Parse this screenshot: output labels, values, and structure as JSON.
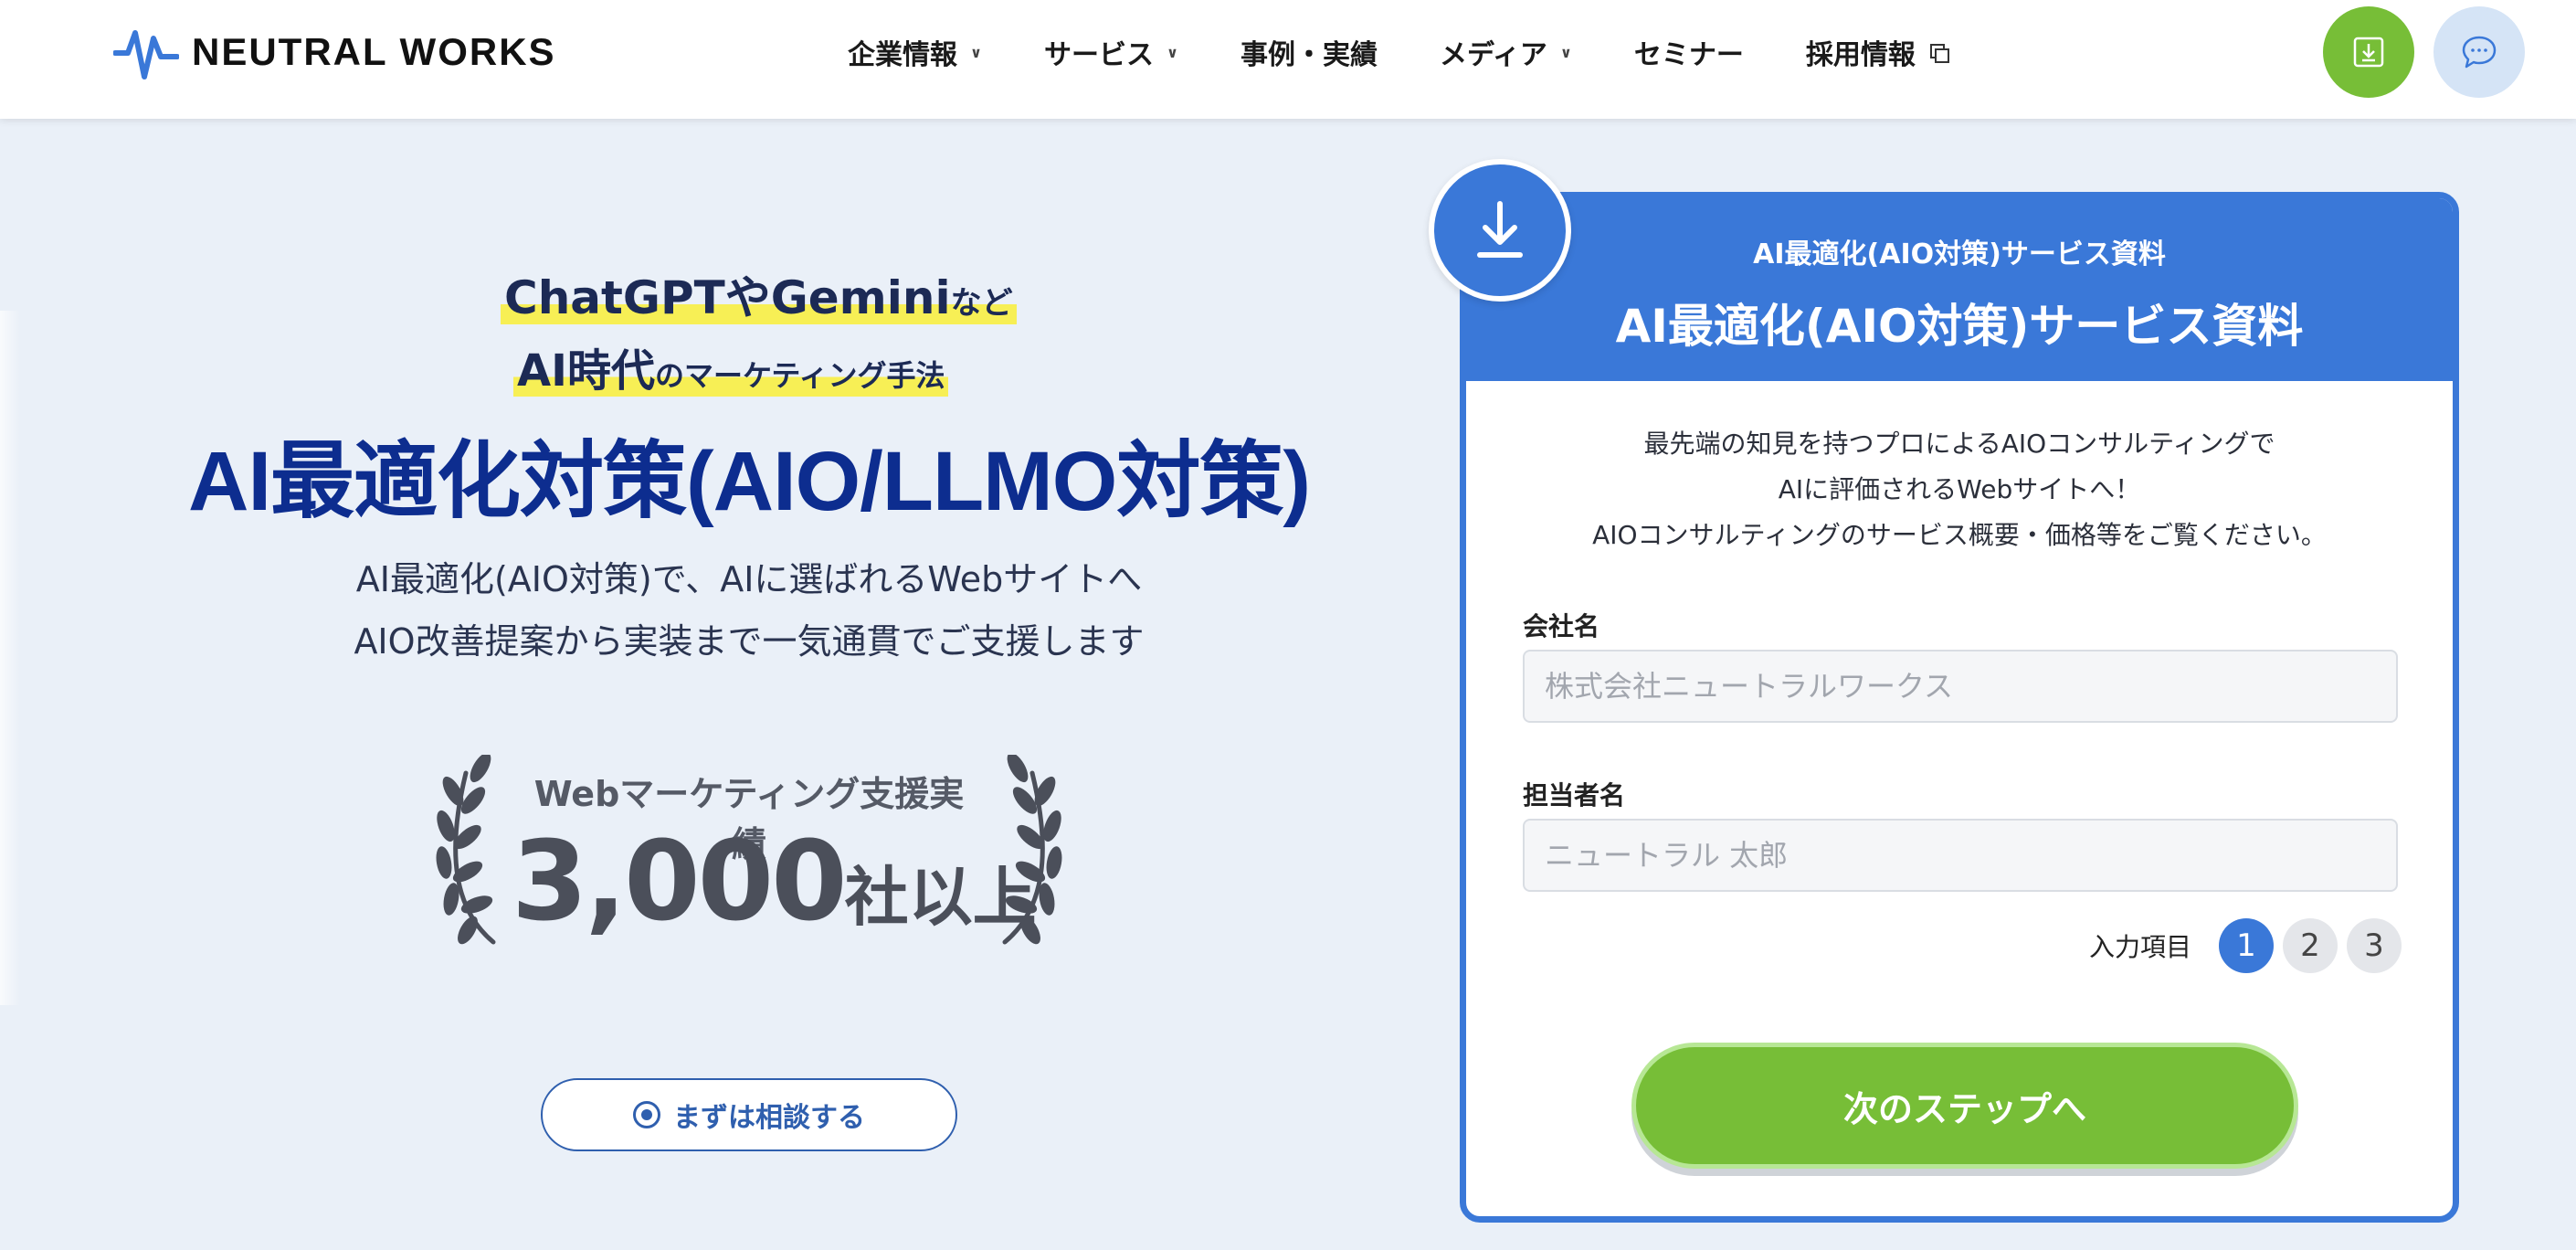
{
  "header": {
    "logo_text": "NEUTRAL WORKS",
    "nav": [
      {
        "label": "企業情報",
        "icon": "chevron-down-icon"
      },
      {
        "label": "サービス",
        "icon": "chevron-down-icon"
      },
      {
        "label": "事例・実績",
        "icon": ""
      },
      {
        "label": "メディア",
        "icon": "chevron-down-icon"
      },
      {
        "label": "セミナー",
        "icon": ""
      },
      {
        "label": "採用情報",
        "icon": "external-link-icon"
      }
    ],
    "download_icon": "download-icon",
    "chat_icon": "chat-bubble-icon",
    "download_button_color": "#77be37",
    "chat_button_color": "#d5e4f6"
  },
  "hero": {
    "tagline1_main": "ChatGPTやGemini",
    "tagline1_small": "など",
    "tagline2_main": "AI時代",
    "tagline2_small": "のマーケティング手法",
    "title": "AI最適化対策(AIO/LLMO対策)",
    "subtitle_line1": "AI最適化(AIO対策)で、AIに選ばれるWebサイトへ",
    "subtitle_line2": "AIO改善提案から実装まで一気通貫でご支援します",
    "award_label": "Webマーケティング支援実績",
    "award_number": "3,000",
    "award_unit": "社以上",
    "consult_button": "まずは相談する",
    "title_color": "#0d2d8f",
    "highlight_color": "#f7ef55"
  },
  "form": {
    "header_sub": "AI最適化(AIO対策)サービス資料",
    "header_title": "AI最適化(AIO対策)サービス資料",
    "intro_line1": "最先端の知見を持つプロによるAIOコンサルティングで",
    "intro_line2": "AIに評価されるWebサイトへ！",
    "intro_line3": "AIOコンサルティングのサービス概要・価格等をご覧ください。",
    "company_label": "会社名",
    "company_placeholder": "株式会社ニュートラルワークス",
    "person_label": "担当者名",
    "person_placeholder": "ニュートラル 太郎",
    "steps_label": "入力項目",
    "steps": [
      "1",
      "2",
      "3"
    ],
    "active_step": "1",
    "next_button": "次のステップへ",
    "accent_color": "#3a78d8",
    "button_color": "#77be37"
  }
}
